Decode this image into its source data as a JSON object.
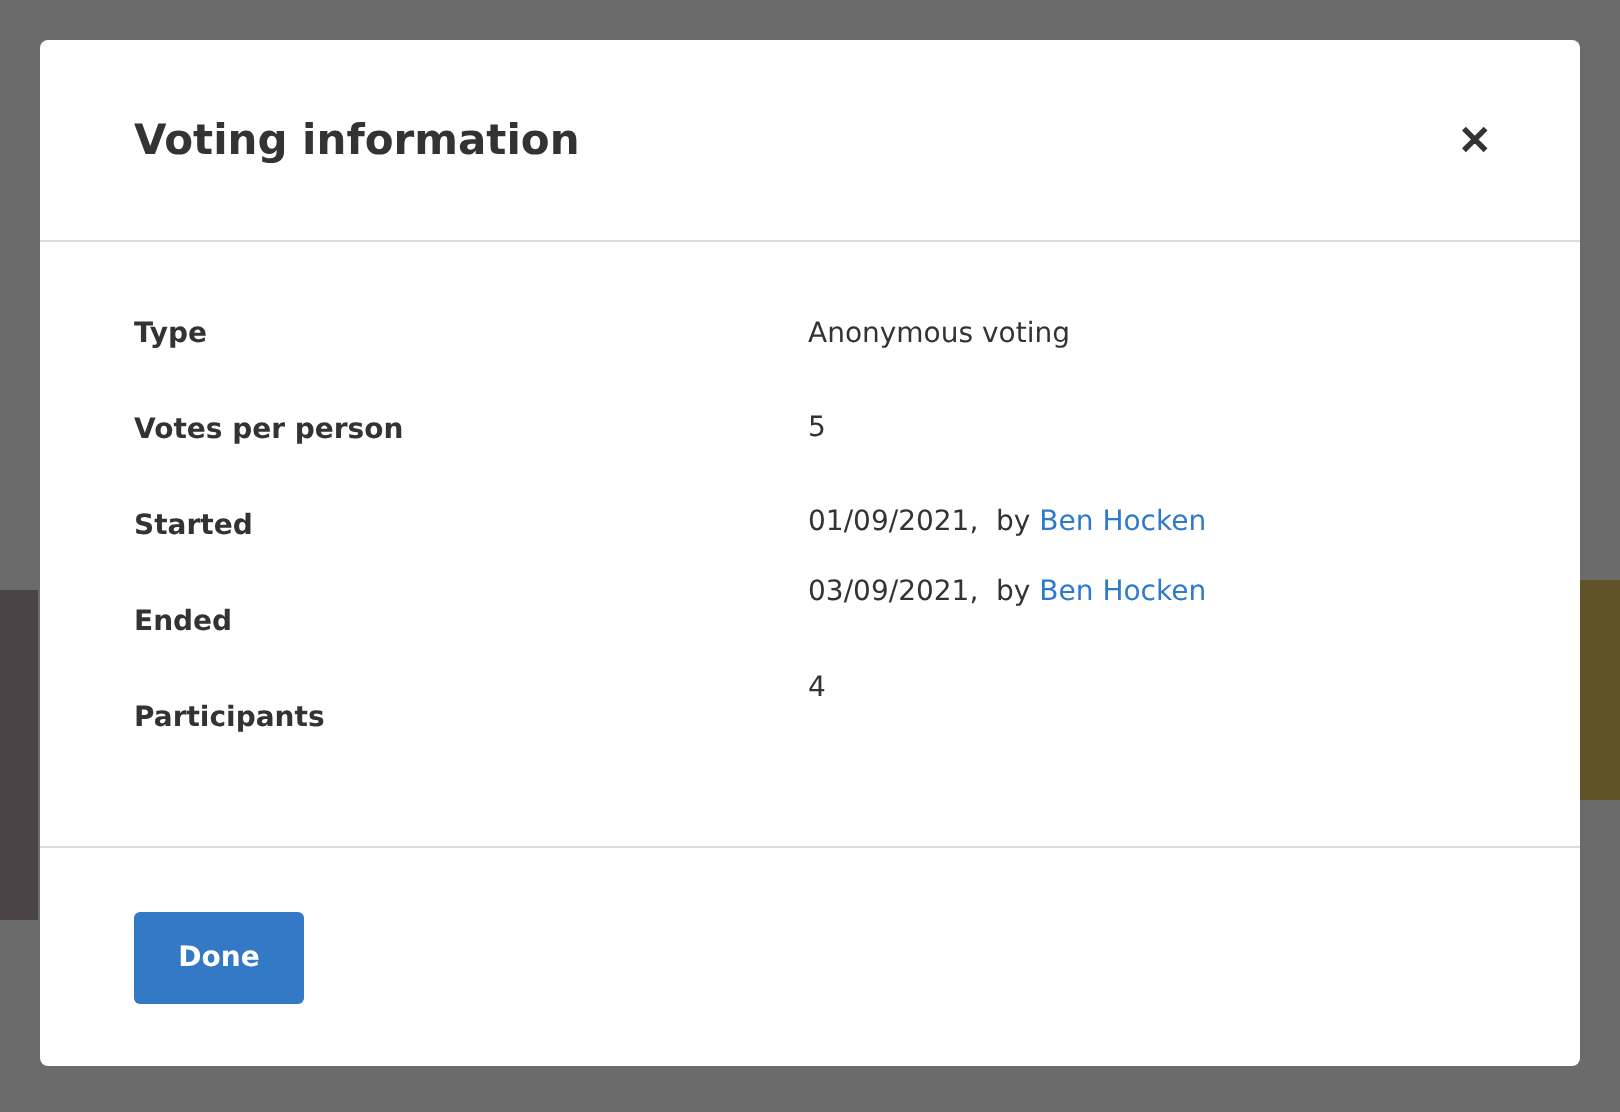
{
  "dialog": {
    "title": "Voting information",
    "close": "✕"
  },
  "labels": [
    "Type",
    "Votes per person",
    "Started",
    "Ended",
    "Participants"
  ],
  "values": [
    {
      "kind": "text",
      "text": "Anonymous voting"
    },
    {
      "kind": "text",
      "text": "5"
    },
    {
      "kind": "by",
      "text": "01/09/2021,  by ",
      "link": "Ben Hocken"
    },
    {
      "kind": "by",
      "text": "03/09/2021,  by ",
      "link": "Ben Hocken"
    },
    {
      "kind": "text",
      "text": "4"
    }
  ],
  "buttons": [
    "Done"
  ]
}
